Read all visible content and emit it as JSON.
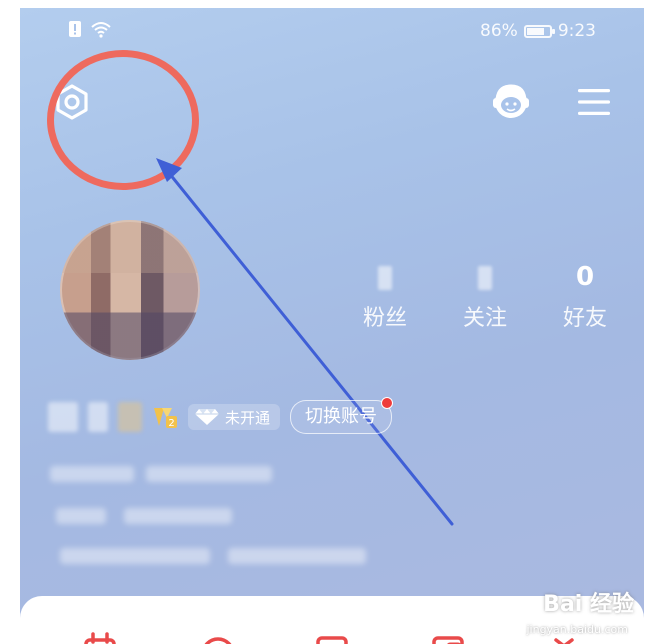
{
  "status_bar": {
    "battery_percent": "86%",
    "battery_level": 0.86,
    "time": "9:23",
    "icons": [
      "alert-icon",
      "wifi-icon",
      "battery-icon"
    ]
  },
  "header": {
    "settings_icon": "gear-icon",
    "service_icon": "customer-service-icon",
    "menu_icon": "menu-icon"
  },
  "profile": {
    "stats": [
      {
        "value": "",
        "label": "粉丝"
      },
      {
        "value": "",
        "label": "关注"
      },
      {
        "value": "0",
        "label": "好友"
      }
    ],
    "vip_level": "2",
    "membership_status": "未开通",
    "switch_account_label": "切换账号"
  },
  "bottom_nav": {
    "icons": [
      "calendar-icon",
      "music-disc-icon",
      "message-icon",
      "wallet-icon",
      "gift-icon"
    ]
  },
  "watermark": {
    "brand": "Bai 经验",
    "url": "jingyan.baidu.com"
  },
  "colors": {
    "annotation_circle": "#ee6a5e",
    "annotation_arrow": "#3f5fd6",
    "accent_red": "#e94a4a"
  }
}
